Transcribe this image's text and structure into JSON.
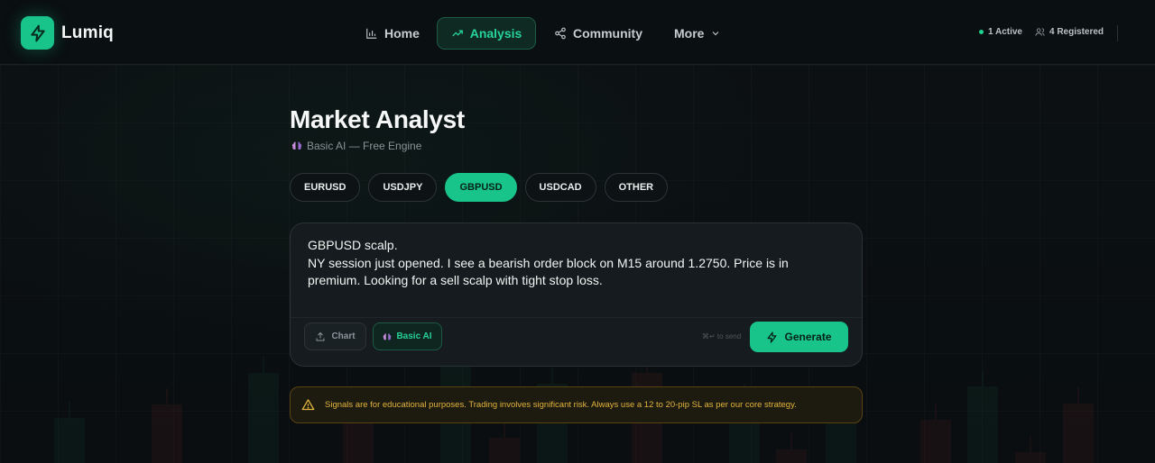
{
  "brand": {
    "name": "Lumiq",
    "accent": "#18c48a"
  },
  "nav": [
    {
      "label": "Home",
      "icon": "bar-chart-icon"
    },
    {
      "label": "Analysis",
      "icon": "trend-up-icon",
      "active": true
    },
    {
      "label": "Community",
      "icon": "share-icon"
    },
    {
      "label": "More",
      "icon": "chevron-down-icon"
    }
  ],
  "status": {
    "active": "1 Active",
    "registered": "4 Registered"
  },
  "page": {
    "title": "Market Analyst",
    "subtitle": "Basic AI — Free Engine"
  },
  "pairs": [
    {
      "label": "EURUSD"
    },
    {
      "label": "USDJPY"
    },
    {
      "label": "GBPUSD",
      "active": true
    },
    {
      "label": "USDCAD"
    },
    {
      "label": "OTHER"
    }
  ],
  "composer": {
    "text": "GBPUSD scalp.\nNY session just opened. I see a bearish order block on M15 around 1.2750. Price is in premium. Looking for a sell scalp with tight stop loss.",
    "chart_label": "Chart",
    "model_label": "Basic AI",
    "send_hint": "⌘↵ to send",
    "generate_label": "Generate"
  },
  "warning": {
    "text": "Signals are for educational purposes. Trading involves significant risk. Always use a 12 to 20-pip SL as per our core strategy.",
    "color": "#e1b43c"
  }
}
